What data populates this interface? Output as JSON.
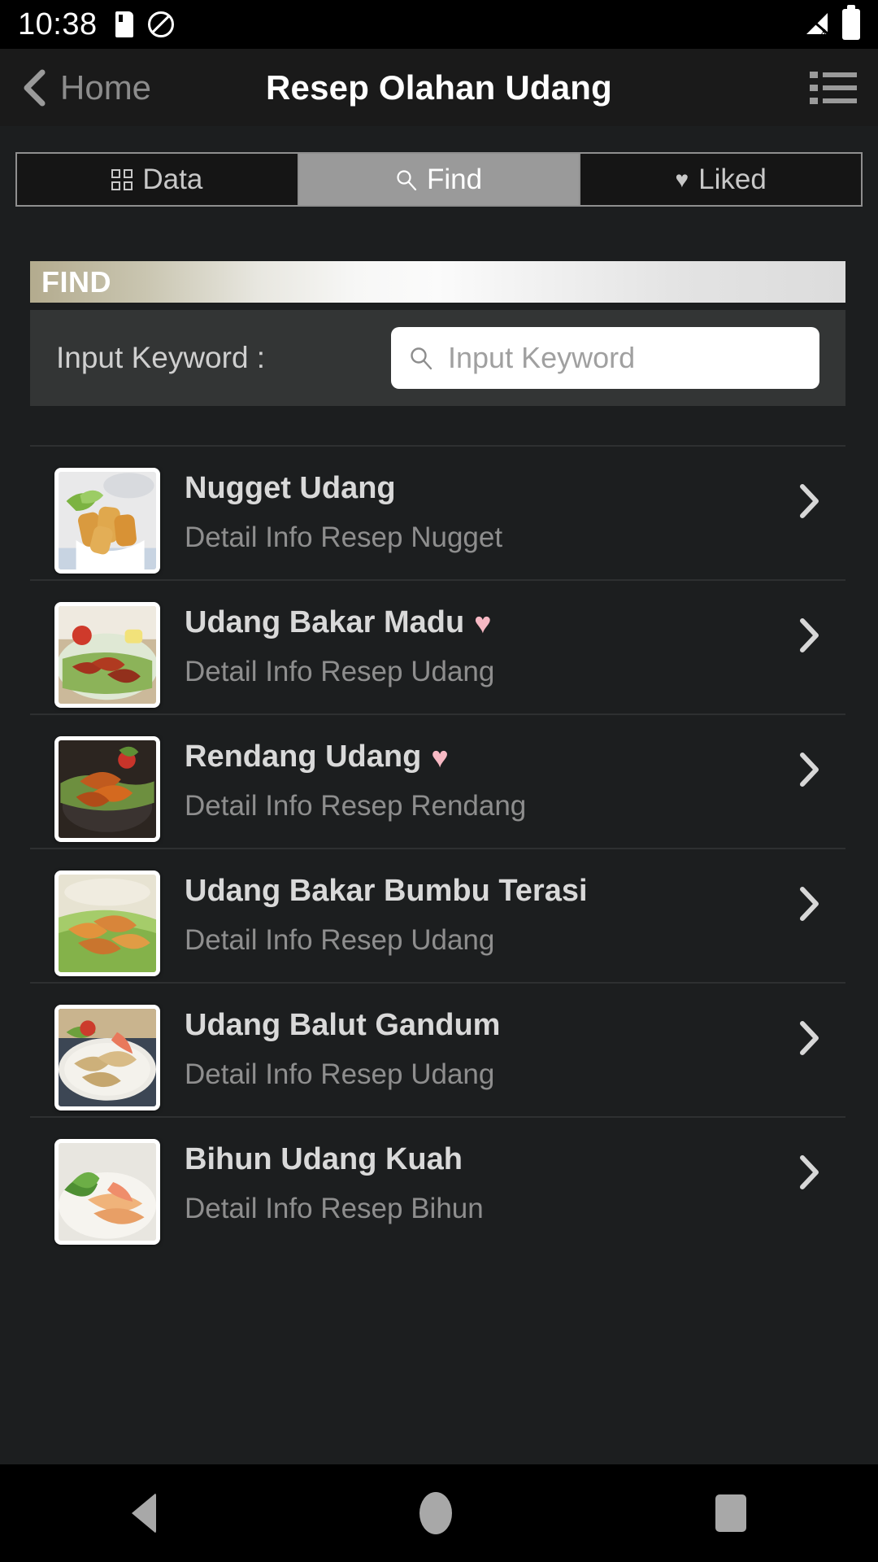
{
  "status_bar": {
    "time": "10:38",
    "icons": [
      "sd-card-icon",
      "do-not-disturb-icon",
      "signal-off-icon",
      "battery-full-icon"
    ]
  },
  "header": {
    "back_label": "Home",
    "title": "Resep Olahan Udang",
    "menu_icon": "list-menu-icon"
  },
  "tabs": [
    {
      "label": "Data",
      "icon": "grid-icon",
      "active": false
    },
    {
      "label": "Find",
      "icon": "search-icon",
      "active": true
    },
    {
      "label": "Liked",
      "icon": "heart-icon",
      "active": false
    }
  ],
  "find_panel": {
    "bar_label": "FIND",
    "keyword_label": "Input Keyword :",
    "keyword_value": "",
    "keyword_placeholder": "Input Keyword",
    "search_icon": "search-icon"
  },
  "results": [
    {
      "title": "Nugget Udang",
      "subtitle": "Detail Info Resep Nugget",
      "liked": false,
      "thumb": "fried-shrimp-nuggets-in-white-bowl-with-lettuce"
    },
    {
      "title": "Udang Bakar Madu",
      "subtitle": "Detail Info Resep Udang",
      "liked": true,
      "thumb": "grilled-honey-shrimp-on-green-banana-leaf-plate"
    },
    {
      "title": "Rendang Udang",
      "subtitle": "Detail Info Resep Rendang",
      "liked": true,
      "thumb": "shrimp-rendang-in-red-sauce-on-dark-plate"
    },
    {
      "title": "Udang Bakar Bumbu Terasi",
      "subtitle": "Detail Info Resep Udang",
      "liked": false,
      "thumb": "grilled-shrimp-with-shrimp-paste-on-green-leaf"
    },
    {
      "title": "Udang Balut Gandum",
      "subtitle": "Detail Info Resep Udang",
      "liked": false,
      "thumb": "oat-crusted-shrimp-on-white-plate"
    },
    {
      "title": "Bihun Udang Kuah",
      "subtitle": "Detail Info Resep Bihun",
      "liked": false,
      "thumb": "shrimp-vermicelli-soup-with-greens"
    }
  ],
  "nav_bar": {
    "back": "back-triangle-icon",
    "home": "home-circle-icon",
    "recents": "recents-square-icon"
  },
  "colors": {
    "page_bg": "#1c1e1f",
    "header_bg": "#1a1a1a",
    "tab_active_bg": "#9a9a9a",
    "panel_bg": "#333535",
    "liked_heart": "#f7b9c4",
    "title_text": "#d9d9d9",
    "sub_text": "#8e8e8e"
  }
}
